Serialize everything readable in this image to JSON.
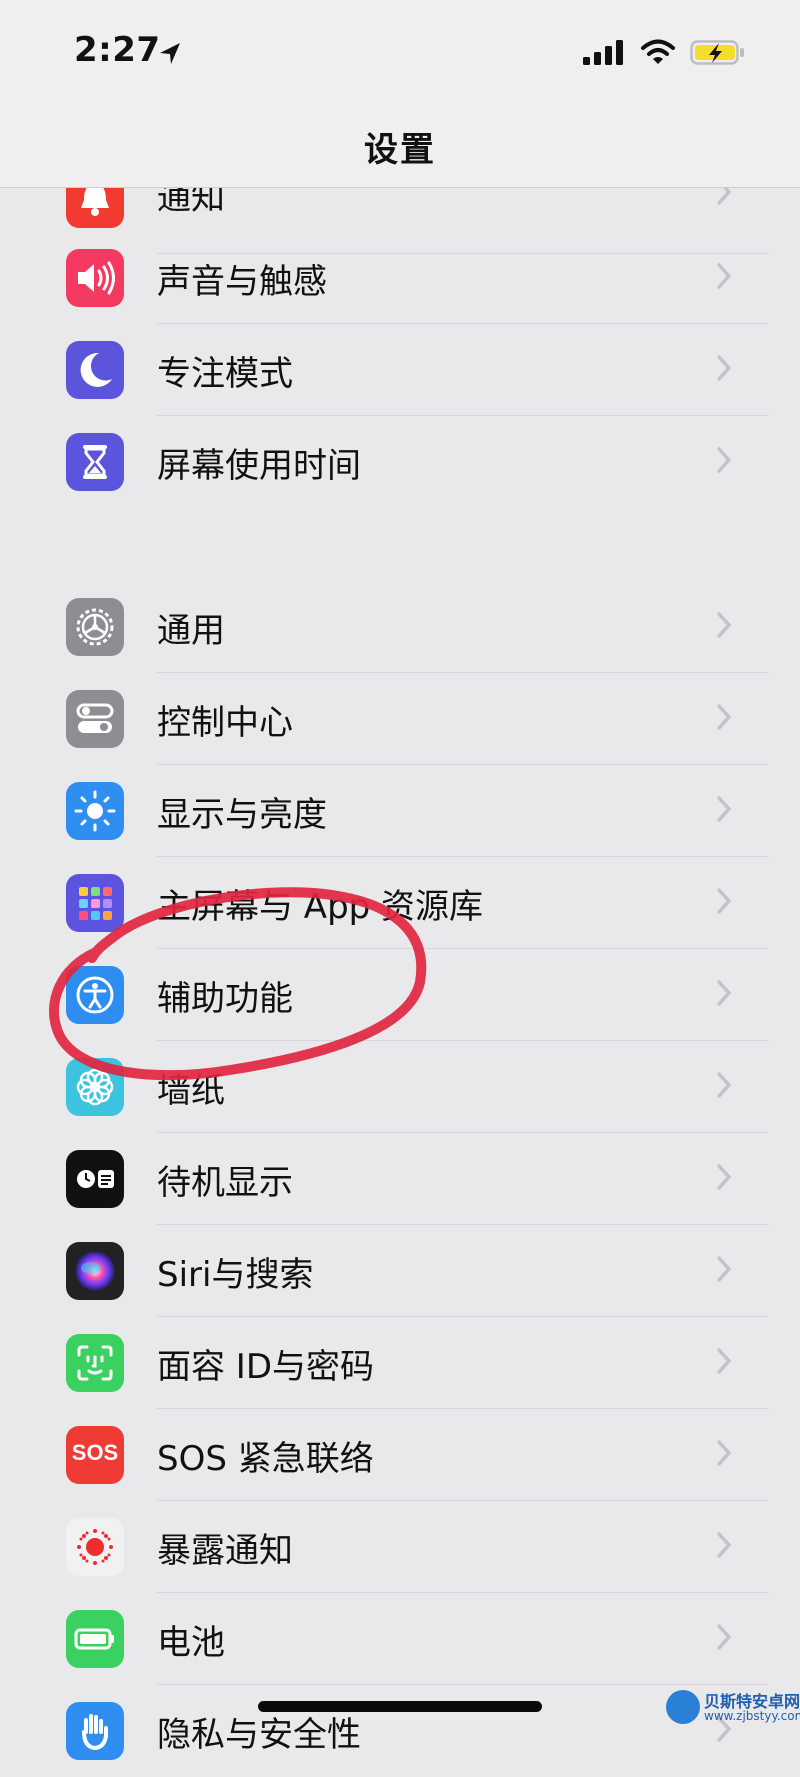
{
  "status_bar": {
    "time": "2:27"
  },
  "nav": {
    "title": "设置"
  },
  "rows": [
    {
      "label": "通知",
      "icon": "bell-icon",
      "color": "#f23b30"
    },
    {
      "label": "声音与触感",
      "icon": "speaker-icon",
      "color": "#f43a61"
    },
    {
      "label": "专注模式",
      "icon": "moon-icon",
      "color": "#5b55dc"
    },
    {
      "label": "屏幕使用时间",
      "icon": "hourglass-icon",
      "color": "#5a55dc"
    },
    {
      "label": "通用",
      "icon": "gear-icon",
      "color": "#8e8d93"
    },
    {
      "label": "控制中心",
      "icon": "toggles-icon",
      "color": "#8e8d93"
    },
    {
      "label": "显示与亮度",
      "icon": "sun-icon",
      "color": "#2f8ff0"
    },
    {
      "label": "主屏幕与 App 资源库",
      "icon": "app-grid-icon",
      "color": "#5c53df"
    },
    {
      "label": "辅助功能",
      "icon": "accessibility-icon",
      "color": "#2d8ef0"
    },
    {
      "label": "墙纸",
      "icon": "flower-icon",
      "color": "#3cc3de"
    },
    {
      "label": "待机显示",
      "icon": "standby-icon",
      "color": "#111111"
    },
    {
      "label": "Siri与搜索",
      "icon": "siri-icon",
      "color": "#222222"
    },
    {
      "label": "面容 ID与密码",
      "icon": "face-id-icon",
      "color": "#3ad160"
    },
    {
      "label": "SOS 紧急联络",
      "icon": "sos-icon",
      "color": "#ef3b33"
    },
    {
      "label": "暴露通知",
      "icon": "exposure-icon",
      "color": "#f1f0f2"
    },
    {
      "label": "电池",
      "icon": "battery-icon",
      "color": "#3ad160"
    },
    {
      "label": "隐私与安全性",
      "icon": "hand-icon",
      "color": "#2f8ff0"
    }
  ],
  "icon_texts": {
    "sos": "SOS"
  },
  "annotation": {
    "color": "#e0263f",
    "target": "辅助功能"
  },
  "watermark": {
    "line1": "贝斯特安卓网",
    "line2": "www.zjbstyy.com"
  }
}
